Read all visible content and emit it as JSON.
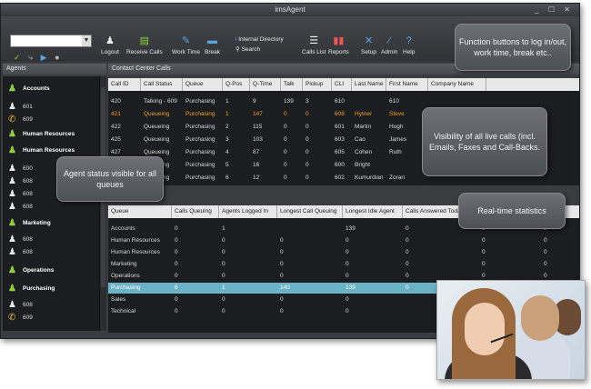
{
  "app": {
    "title": "imsAgent",
    "window_buttons": "_ ☐ ✕"
  },
  "toolbar": {
    "buttons": [
      {
        "label": "Logout",
        "icon": "logout-icon"
      },
      {
        "label": "Receive Calls",
        "icon": "receive-calls-icon"
      },
      {
        "label": "Work Time",
        "icon": "work-time-icon"
      },
      {
        "label": "Break",
        "icon": "break-icon"
      },
      {
        "label": "Calls List",
        "icon": "calls-list-icon"
      },
      {
        "label": "Reports",
        "icon": "reports-icon"
      },
      {
        "label": "Setup",
        "icon": "setup-icon"
      },
      {
        "label": "Admin",
        "icon": "admin-icon"
      },
      {
        "label": "Help",
        "icon": "help-icon"
      }
    ],
    "internal_directory": "Internal Directory",
    "search": "Search"
  },
  "agents_panel": {
    "title": "Agents",
    "rows": [
      {
        "text": "Accounts",
        "group": true
      },
      {
        "text": "601",
        "group": false
      },
      {
        "text": "609",
        "group": false
      },
      {
        "text": "Human Resources",
        "group": true
      },
      {
        "text": "Human Resources",
        "group": true
      },
      {
        "text": "600",
        "group": false
      },
      {
        "text": "608",
        "group": false
      },
      {
        "text": "608",
        "group": false
      },
      {
        "text": "608",
        "group": false
      },
      {
        "text": "Marketing",
        "group": true
      },
      {
        "text": "608",
        "group": false
      },
      {
        "text": "608",
        "group": false
      },
      {
        "text": "Operations",
        "group": true
      },
      {
        "text": "Purchasing",
        "group": true
      },
      {
        "text": "608",
        "group": false
      },
      {
        "text": "609",
        "group": false
      }
    ]
  },
  "contact_center": {
    "title": "Contact Center Calls",
    "columns": [
      "Call ID",
      "Call Status",
      "Queue",
      "Q-Pos",
      "Q-Time",
      "Talk",
      "Pickup",
      "CLI",
      "Last Name",
      "First Name",
      "Company Name"
    ],
    "rows": [
      [
        "420",
        "Talking - 609",
        "Purchasing",
        "1",
        "9",
        "139",
        "3",
        "610",
        "",
        "610",
        ""
      ],
      [
        "421",
        "Queueing",
        "Purchasing",
        "1",
        "147",
        "0",
        "0",
        "608",
        "Hytner",
        "Steve",
        ""
      ],
      [
        "422",
        "Queueing",
        "Purchasing",
        "2",
        "115",
        "0",
        "0",
        "601",
        "Martin",
        "Hugh",
        ""
      ],
      [
        "425",
        "Queueing",
        "Purchasing",
        "3",
        "103",
        "0",
        "0",
        "603",
        "Cao",
        "James",
        ""
      ],
      [
        "427",
        "Queueing",
        "Purchasing",
        "4",
        "87",
        "0",
        "0",
        "605",
        "Cohen",
        "Ruth",
        ""
      ],
      [
        "429",
        "Queueing",
        "Purchasing",
        "5",
        "16",
        "0",
        "0",
        "600",
        "Bright",
        "",
        ""
      ],
      [
        "431",
        "Queueing",
        "Purchasing",
        "6",
        "12",
        "0",
        "0",
        "602",
        "Kumurdian",
        "Zoran",
        ""
      ]
    ]
  },
  "stats": {
    "columns": [
      "Queue",
      "Calls Queuing",
      "Agents Logged In",
      "Longest Call Queuing",
      "Longest Idle Agent",
      "Calls Answered Today"
    ],
    "rows": [
      [
        "Accounts",
        "0",
        "1",
        "",
        "139",
        "0",
        "0",
        "0"
      ],
      [
        "Human Resources",
        "0",
        "0",
        "0",
        "0",
        "0",
        "0",
        "0"
      ],
      [
        "Human Resources",
        "0",
        "0",
        "0",
        "0",
        "0",
        "0",
        "0"
      ],
      [
        "Marketing",
        "0",
        "0",
        "0",
        "0",
        "0",
        "0",
        "0"
      ],
      [
        "Operations",
        "0",
        "0",
        "0",
        "0",
        "0",
        "0",
        "0"
      ],
      [
        "Purchasing",
        "6",
        "1",
        "140",
        "139",
        "0",
        "",
        ""
      ],
      [
        "Sales",
        "0",
        "0",
        "0",
        "0",
        "",
        "",
        ""
      ],
      [
        "Technical",
        "0",
        "0",
        "0",
        "0",
        "",
        "",
        ""
      ]
    ]
  },
  "callouts": {
    "function_buttons": "Function buttons to log in/out, work time, break etc..",
    "live_calls": "Visibility of all live calls (incl. Emails, Faxes and Call-Backs.",
    "agent_status": "Agent status visible for all queues",
    "realtime": "Real-time statistics"
  }
}
